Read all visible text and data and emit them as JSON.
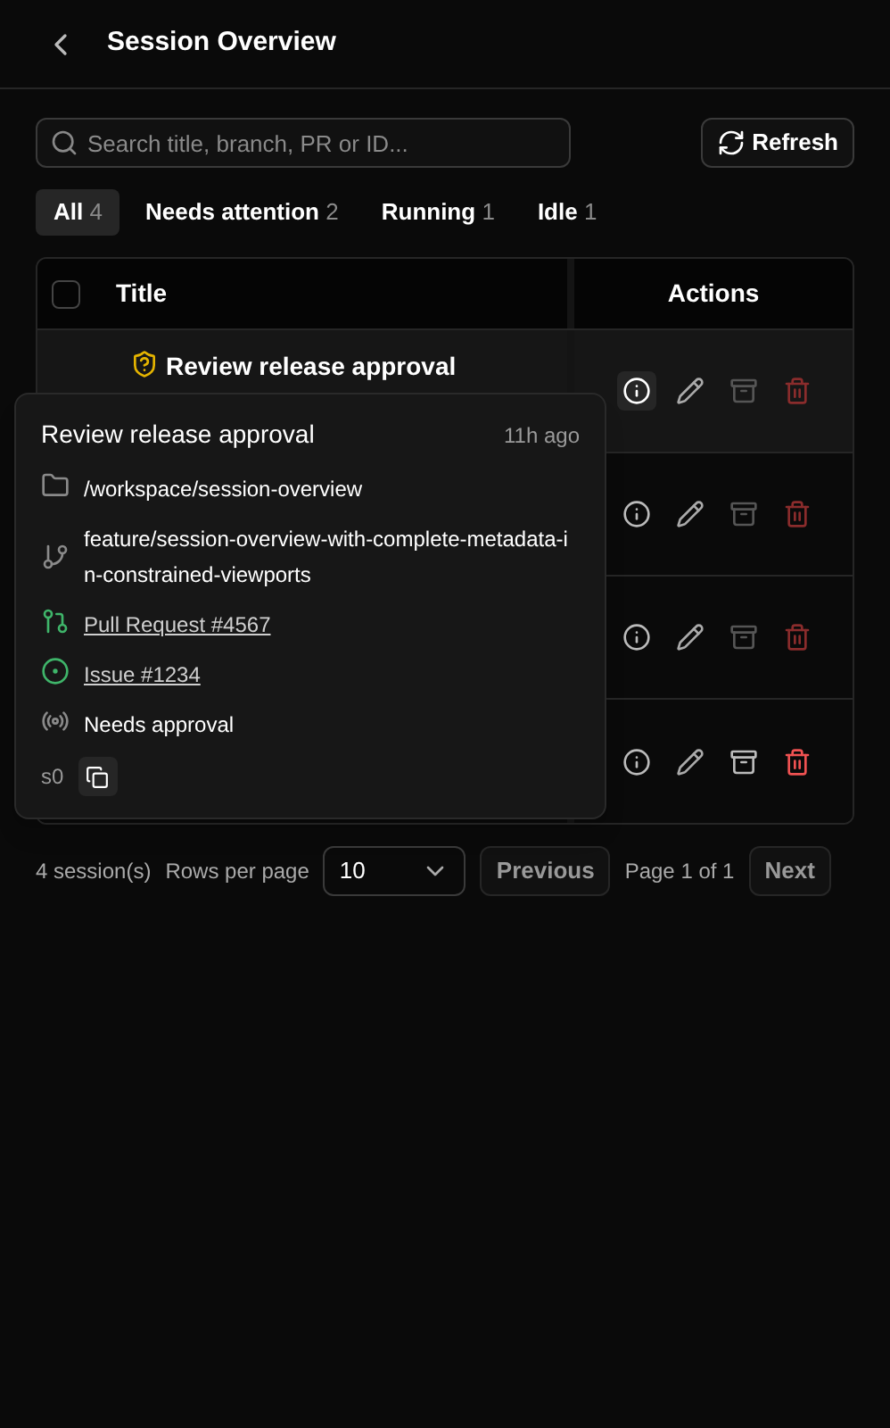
{
  "header": {
    "title": "Session Overview"
  },
  "search": {
    "placeholder": "Search title, branch, PR or ID..."
  },
  "refresh_button": "Refresh",
  "tabs": [
    {
      "label": "All",
      "count": "4",
      "selected": true
    },
    {
      "label": "Needs attention",
      "count": "2",
      "selected": false
    },
    {
      "label": "Running",
      "count": "1",
      "selected": false
    },
    {
      "label": "Idle",
      "count": "1",
      "selected": false
    }
  ],
  "table": {
    "select_all_checked": false,
    "columns": [
      "Title",
      "Actions"
    ],
    "rows": [
      {
        "title": "Review release approval",
        "highlighted": true,
        "info_active": true,
        "archive_disabled": true,
        "delete_disabled": true
      },
      {
        "highlighted": false,
        "info_active": false,
        "archive_disabled": true,
        "delete_disabled": true
      },
      {
        "highlighted": false,
        "info_active": false,
        "archive_disabled": true,
        "delete_disabled": true
      },
      {
        "highlighted": false,
        "info_active": false,
        "archive_disabled": false,
        "delete_disabled": false
      }
    ]
  },
  "popover": {
    "title": "Review release approval",
    "time": "11h ago",
    "details": [
      {
        "kind": "folder",
        "text": "/workspace/session-overview"
      },
      {
        "kind": "branch",
        "text": "feature/session-overview-with-complete-metadata-in-constrained-viewports"
      },
      {
        "kind": "pull_request",
        "text": "Pull Request #4567"
      },
      {
        "kind": "issue",
        "text": "Issue #1234"
      },
      {
        "kind": "status",
        "text": "Needs approval"
      }
    ],
    "id": "s0"
  },
  "pagination": {
    "count": "4 session(s)",
    "rows_label": "Rows per page",
    "rows_value": "10",
    "previous": "Previous",
    "page": "Page 1 of 1",
    "next": "Next"
  }
}
